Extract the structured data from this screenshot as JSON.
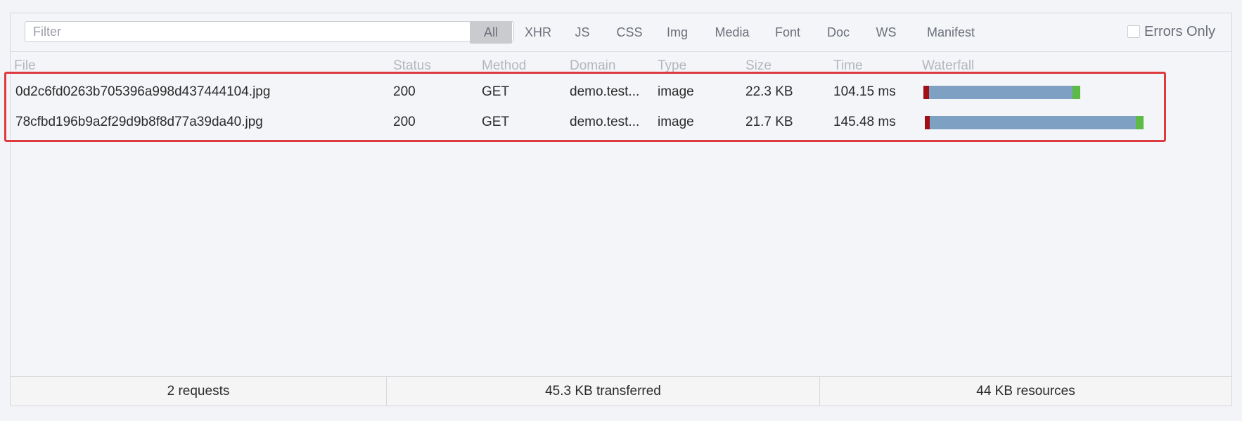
{
  "toolbar": {
    "filter_placeholder": "Filter",
    "filter_value": "",
    "types": [
      "All",
      "XHR",
      "JS",
      "CSS",
      "Img",
      "Media",
      "Font",
      "Doc",
      "WS",
      "Manifest"
    ],
    "active_type": "All",
    "errors_only_label": "Errors Only",
    "errors_only_checked": false
  },
  "table": {
    "columns": [
      "File",
      "Status",
      "Method",
      "Domain",
      "Type",
      "Size",
      "Time",
      "Waterfall"
    ],
    "rows": [
      {
        "file": "0d2c6fd0263b705396a998d437444104.jpg",
        "status": "200",
        "method": "GET",
        "domain": "demo.test...",
        "type": "image",
        "size": "22.3 KB",
        "time": "104.15 ms"
      },
      {
        "file": "78cfbd196b9a2f29d9b8f8d77a39da40.jpg",
        "status": "200",
        "method": "GET",
        "domain": "demo.test...",
        "type": "image",
        "size": "21.7 KB",
        "time": "145.48 ms"
      }
    ]
  },
  "footer": {
    "requests": "2 requests",
    "transferred": "45.3 KB transferred",
    "resources": "44 KB resources"
  },
  "colors": {
    "waterfall_wait": "#a00f14",
    "waterfall_receive": "#7da0c3",
    "waterfall_done": "#5cba45",
    "highlight": "#dd3b3f",
    "active_filter_bg": "#c9cbcf"
  }
}
